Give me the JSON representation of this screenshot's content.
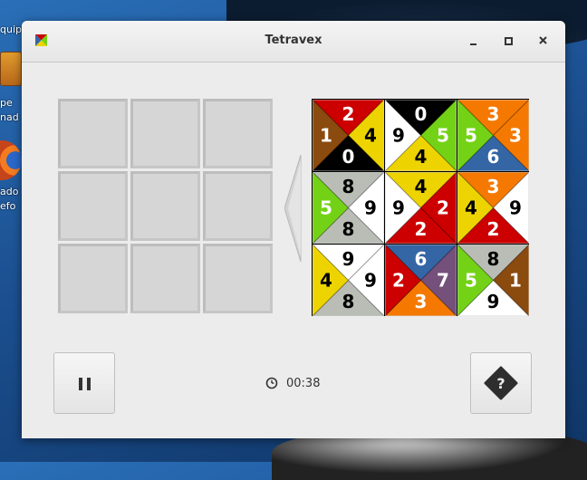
{
  "window": {
    "title": "Tetravex"
  },
  "desktop": {
    "icon_labels": [
      "quip",
      "pe",
      "nad",
      "ado",
      "efo"
    ]
  },
  "timer": {
    "value": "00:38"
  },
  "colors": {
    "0": "#000000",
    "1": "#8b4a0e",
    "2": "#cc0000",
    "3": "#f57900",
    "4": "#edd400",
    "5": "#73d216",
    "6": "#3465a4",
    "7": "#75507b",
    "8": "#babdb6",
    "9": "#ffffff"
  },
  "tiles": [
    {
      "north": 2,
      "east": 4,
      "south": 0,
      "west": 1
    },
    {
      "north": 0,
      "east": 5,
      "south": 4,
      "west": 9
    },
    {
      "north": 3,
      "east": 3,
      "south": 6,
      "west": 5
    },
    {
      "north": 8,
      "east": 9,
      "south": 8,
      "west": 5
    },
    {
      "north": 4,
      "east": 2,
      "south": 2,
      "west": 9
    },
    {
      "north": 3,
      "east": 9,
      "south": 2,
      "west": 4
    },
    {
      "north": 9,
      "east": 9,
      "south": 8,
      "west": 4
    },
    {
      "north": 6,
      "east": 7,
      "south": 3,
      "west": 2
    },
    {
      "north": 8,
      "east": 1,
      "south": 9,
      "west": 5
    }
  ],
  "icons": {
    "app": "tetravex-app-icon",
    "minimize": "minimize-icon",
    "maximize": "maximize-icon",
    "close": "close-icon",
    "pause": "pause-icon",
    "help": "help-icon",
    "clock": "clock-icon",
    "move_left": "arrow-left-icon"
  }
}
